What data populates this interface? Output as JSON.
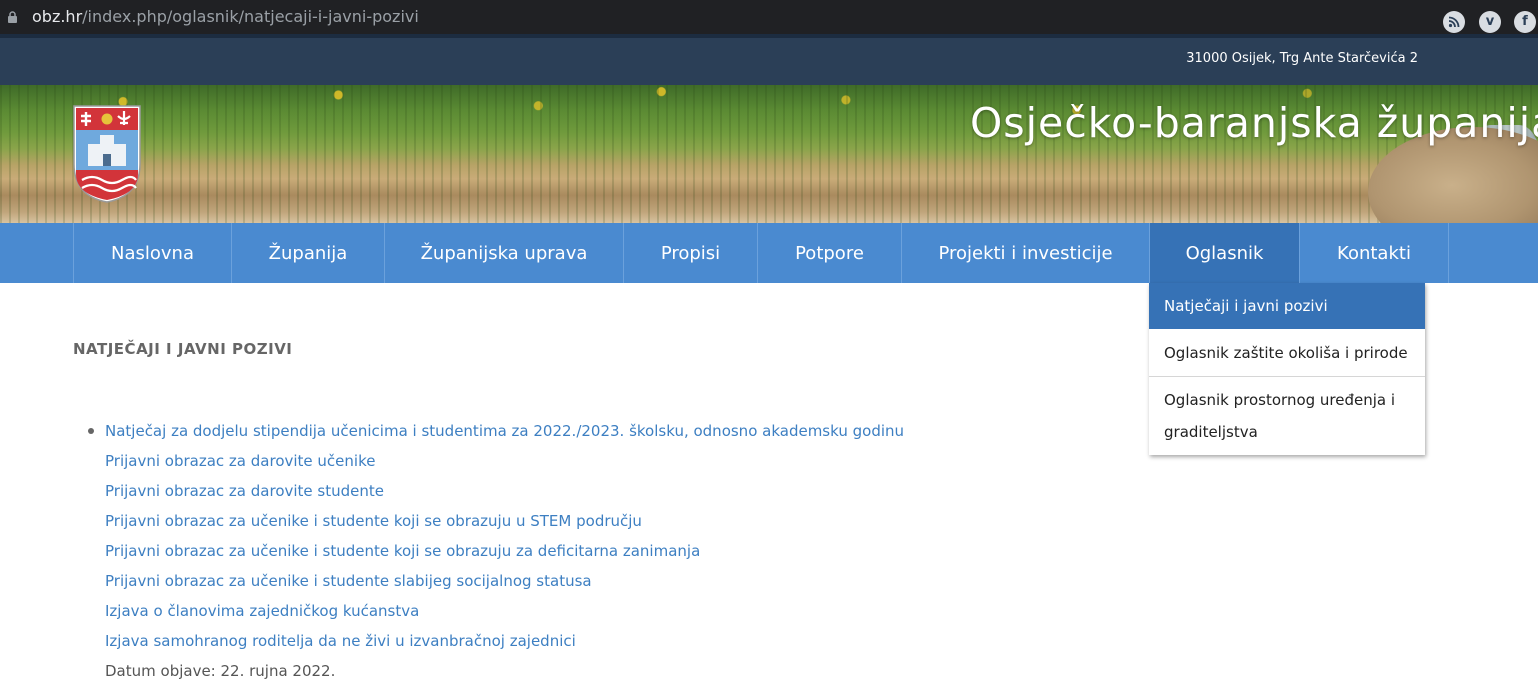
{
  "browser": {
    "url_domain": "obz.hr",
    "url_path": "/index.php/oglasnik/natjecaji-i-javni-pozivi"
  },
  "topbar": {
    "address": "31000 Osijek, Trg Ante Starčevića 2",
    "social": {
      "rss": "rss-icon",
      "vimeo": "vimeo-icon",
      "facebook": "facebook-icon"
    }
  },
  "header": {
    "site_title": "Osječko-baranjska županija"
  },
  "nav": {
    "items": [
      {
        "label": "Naslovna"
      },
      {
        "label": "Županija"
      },
      {
        "label": "Županijska uprava"
      },
      {
        "label": "Propisi"
      },
      {
        "label": "Potpore"
      },
      {
        "label": "Projekti i investicije"
      },
      {
        "label": "Oglasnik",
        "active": true
      },
      {
        "label": "Kontakti"
      }
    ]
  },
  "dropdown": {
    "items": [
      {
        "label": "Natječaji i javni pozivi",
        "selected": true
      },
      {
        "label": "Oglasnik zaštite okoliša i prirode"
      },
      {
        "label": "Oglasnik prostornog uređenja i graditeljstva"
      }
    ]
  },
  "main": {
    "title": "NATJEČAJI I JAVNI POZIVI",
    "links": [
      "Natječaj za dodjelu stipendija učenicima i studentima za 2022./2023. školsku, odnosno akademsku godinu",
      "Prijavni obrazac za darovite učenike",
      "Prijavni obrazac za darovite studente",
      "Prijavni obrazac za učenike i studente koji se obrazuju u STEM području",
      "Prijavni obrazac za učenike i studente koji se obrazuju za deficitarna zanimanja",
      "Prijavni obrazac za učenike i studente slabijeg socijalnog statusa",
      "Izjava o članovima zajedničkog kućanstva",
      "Izjava samohranog roditelja da ne živi u izvanbračnoj zajednici"
    ],
    "date": "Datum objave: 22. rujna 2022."
  },
  "colors": {
    "nav_bg": "#4a8ad0",
    "nav_active": "#3672b6",
    "topbar_bg": "#2b3f57",
    "link": "#3d7fc2"
  }
}
